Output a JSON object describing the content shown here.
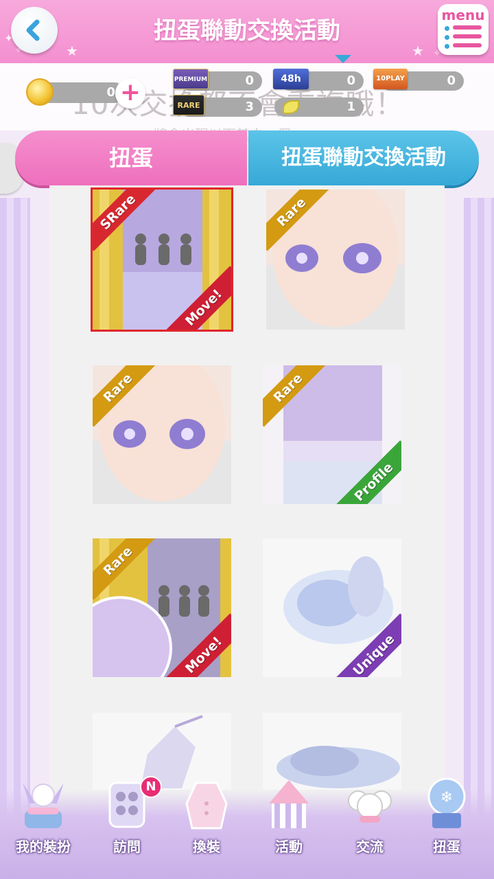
{
  "header": {
    "title": "扭蛋聯動交換活動",
    "menu_label": "menu"
  },
  "currency": {
    "coins": "0",
    "premium_tickets": "0",
    "tickets_48h": "0",
    "tickets_10play": "0",
    "rare_tickets": "3",
    "leaf_tokens": "1",
    "ticket_labels": {
      "premium": "PREMIUM",
      "h48": "48h",
      "play10": "10PLAY",
      "rare": "RARE"
    }
  },
  "background_text": {
    "line1": "10次交換都不會重複哦！",
    "line2": "將會出現以下其中一個"
  },
  "tabs": {
    "left": "扭蛋",
    "right": "扭蛋聯動交換活動"
  },
  "items": [
    {
      "rarity": "SRare",
      "tag": "Move!",
      "kind": "background"
    },
    {
      "rarity": "Rare",
      "tag": "",
      "kind": "face"
    },
    {
      "rarity": "Rare",
      "tag": "",
      "kind": "face"
    },
    {
      "rarity": "Rare",
      "tag": "Profile",
      "kind": "profile"
    },
    {
      "rarity": "Rare",
      "tag": "Move!",
      "kind": "background"
    },
    {
      "rarity": "",
      "tag": "Unique",
      "kind": "outfit"
    },
    {
      "rarity": "",
      "tag": "",
      "kind": "outfit"
    },
    {
      "rarity": "",
      "tag": "",
      "kind": "hair"
    }
  ],
  "nav": [
    {
      "label": "我的裝扮",
      "icon": "snowman-closet-icon"
    },
    {
      "label": "訪問",
      "icon": "visit-icon",
      "badge": "N"
    },
    {
      "label": "換裝",
      "icon": "dress-icon"
    },
    {
      "label": "活動",
      "icon": "tent-icon"
    },
    {
      "label": "交流",
      "icon": "friends-icon"
    },
    {
      "label": "扭蛋",
      "icon": "gacha-machine-icon"
    }
  ],
  "colors": {
    "header_pink": "#f48fd0",
    "tab_pink": "#ee6fbd",
    "tab_blue": "#36a9d8",
    "srare_red": "#d8282f",
    "rare_gold": "#d39a12",
    "move_red": "#cf1f34",
    "profile_green": "#3aa63a",
    "unique_purple": "#7d3db3"
  }
}
